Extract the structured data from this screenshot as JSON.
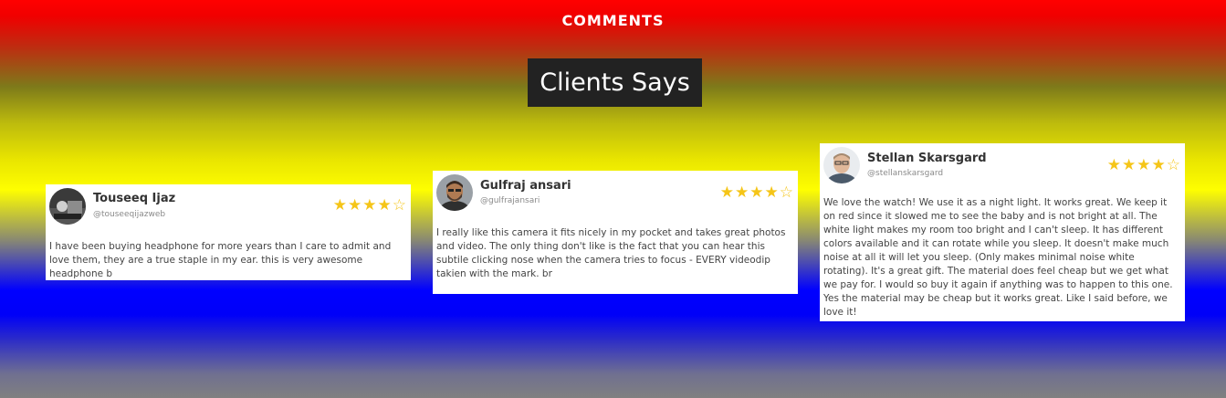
{
  "section": {
    "eyebrow": "COMMENTS",
    "title": "Clients Says"
  },
  "colors": {
    "star": "#f5c518",
    "title_bg": "#222222"
  },
  "reviews": [
    {
      "name": "Touseeq Ijaz",
      "handle": "@touseeqijazweb",
      "rating": 4,
      "max_rating": 5,
      "text": "I have been buying headphone for more years than I care to admit and love them, they are a true staple in my ear. this is very awesome headphone b"
    },
    {
      "name": "Gulfraj ansari",
      "handle": "@gulfrajansari",
      "rating": 4,
      "max_rating": 5,
      "text": "I really like this camera it fits nicely in my pocket and takes great photos and video. The only thing don't like is the fact that you can hear this subtile clicking nose when the camera tries to focus - EVERY videodip takien with the mark. br"
    },
    {
      "name": "Stellan Skarsgard",
      "handle": "@stellanskarsgard",
      "rating": 4,
      "max_rating": 5,
      "text": "We love the watch! We use it as a night light. It works great. We keep it on red since it slowed me to see the baby and is not bright at all. The white light makes my room too bright and I can't sleep. It has different colors available and it can rotate while you sleep. It doesn't make much noise at all it will let you sleep. (Only makes minimal noise white rotating). It's a great gift. The material does feel cheap but we get what we pay for. I would so buy it again if anything was to happen to this one. Yes the material may be cheap but it works great. Like I said before, we love it!"
    }
  ]
}
